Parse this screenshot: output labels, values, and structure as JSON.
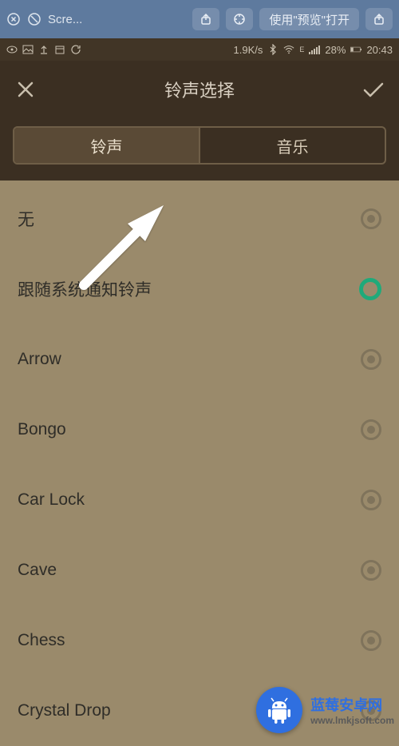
{
  "topbar": {
    "tab_label": "Scre...",
    "open_with_label": "使用\"预览\"打开"
  },
  "statusbar": {
    "speed": "1.9K/s",
    "signal_label": "E",
    "battery": "28%",
    "time": "20:43"
  },
  "header": {
    "title": "铃声选择"
  },
  "tabs": {
    "items": [
      {
        "label": "铃声",
        "active": true
      },
      {
        "label": "音乐",
        "active": false
      }
    ]
  },
  "list": {
    "items": [
      {
        "label": "无",
        "selected": false
      },
      {
        "label": "跟随系统通知铃声",
        "selected": true
      },
      {
        "label": "Arrow",
        "selected": false
      },
      {
        "label": "Bongo",
        "selected": false
      },
      {
        "label": "Car Lock",
        "selected": false
      },
      {
        "label": "Cave",
        "selected": false
      },
      {
        "label": "Chess",
        "selected": false
      },
      {
        "label": "Crystal Drop",
        "selected": false
      }
    ]
  },
  "watermark": {
    "name": "蓝莓安卓网",
    "url": "www.lmkjsoft.com"
  }
}
